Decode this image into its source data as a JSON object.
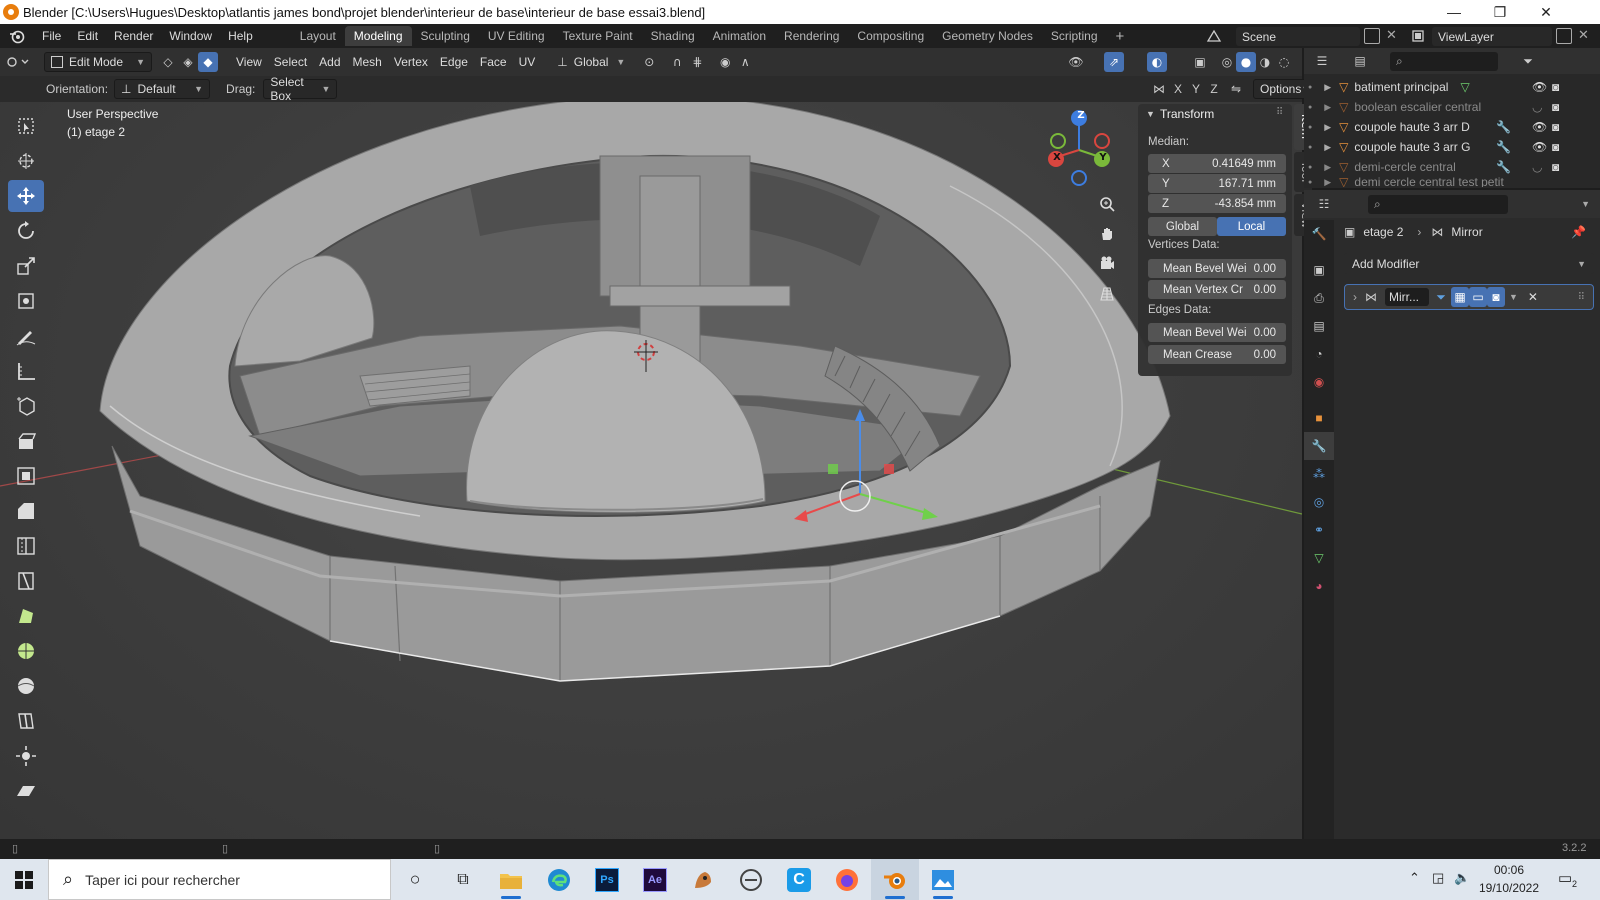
{
  "window": {
    "title": "Blender [C:\\Users\\Hugues\\Desktop\\atlantis james bond\\projet blender\\interieur de base\\interieur de base essai3.blend]",
    "minimize": "—",
    "maximize": "❐",
    "close": "✕"
  },
  "menu": {
    "items": [
      "File",
      "Edit",
      "Render",
      "Window",
      "Help"
    ]
  },
  "workspaces": {
    "tabs": [
      "Layout",
      "Modeling",
      "Sculpting",
      "UV Editing",
      "Texture Paint",
      "Shading",
      "Animation",
      "Rendering",
      "Compositing",
      "Geometry Nodes",
      "Scripting"
    ],
    "active": "Modeling",
    "add": "+"
  },
  "scene": {
    "label": "Scene"
  },
  "view_layer": {
    "label": "ViewLayer"
  },
  "viewport_header": {
    "mode": "Edit Mode",
    "menus": [
      "View",
      "Select",
      "Add",
      "Mesh",
      "Vertex",
      "Edge",
      "Face",
      "UV"
    ],
    "transform_orientation": "Global"
  },
  "tool_settings": {
    "orientation_label": "Orientation:",
    "orientation_value": "Default",
    "drag_label": "Drag:",
    "drag_value": "Select Box",
    "axes": [
      "X",
      "Y",
      "Z"
    ],
    "options": "Options"
  },
  "viewport": {
    "view_name": "User Perspective",
    "object_info": "(1) etage 2"
  },
  "gizmo": {
    "x": "X",
    "y": "Y",
    "z": "Z"
  },
  "npanel": {
    "section": "Transform",
    "median_label": "Median:",
    "x_label": "X",
    "x_value": "0.41649 mm",
    "y_label": "Y",
    "y_value": "167.71 mm",
    "z_label": "Z",
    "z_value": "-43.854 mm",
    "global": "Global",
    "local": "Local",
    "vertices_data": "Vertices Data:",
    "mean_bevel_vert_label": "Mean Bevel Wei",
    "mean_bevel_vert_value": "0.00",
    "mean_vertex_crease_label": "Mean Vertex Cr",
    "mean_vertex_crease_value": "0.00",
    "edges_data": "Edges Data:",
    "mean_bevel_edge_label": "Mean Bevel Wei",
    "mean_bevel_edge_value": "0.00",
    "mean_crease_label": "Mean Crease",
    "mean_crease_value": "0.00"
  },
  "side_tabs": [
    "Item",
    "Tool",
    "View"
  ],
  "outliner": {
    "rows": [
      {
        "name": "batiment principal",
        "dim": false
      },
      {
        "name": "boolean escalier central",
        "dim": true
      },
      {
        "name": "coupole haute 3 arr D",
        "dim": false
      },
      {
        "name": "coupole haute 3 arr G",
        "dim": false
      },
      {
        "name": "demi-cercle central",
        "dim": true
      },
      {
        "name": "demi cercle central test petit",
        "dim": true
      }
    ]
  },
  "properties": {
    "breadcrumb_object": "etage 2",
    "breadcrumb_modifier": "Mirror",
    "add_modifier": "Add Modifier",
    "modifier_name": "Mirr..."
  },
  "statusbar": {
    "version": "3.2.2"
  },
  "taskbar": {
    "search_placeholder": "Taper ici pour rechercher",
    "time": "00:06",
    "date": "19/10/2022",
    "notifications": "2"
  }
}
